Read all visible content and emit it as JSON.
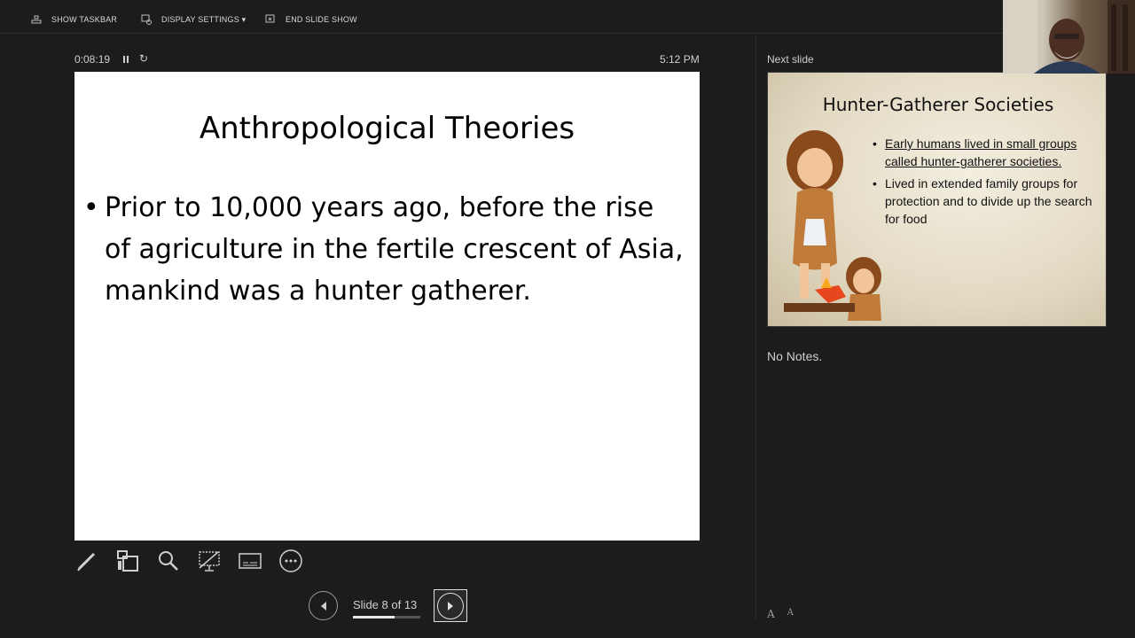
{
  "toolbar": {
    "show_taskbar": "SHOW TASKBAR",
    "display_settings": "DISPLAY SETTINGS ▾",
    "end_slide_show": "END SLIDE SHOW"
  },
  "presenter": {
    "elapsed_time": "0:08:19",
    "clock": "5:12 PM",
    "current_slide": {
      "title": "Anthropological Theories",
      "bullets": [
        "Prior to 10,000 years ago, before the rise of agriculture in the fertile crescent of Asia, mankind was a hunter gatherer."
      ]
    },
    "slide_counter": "Slide 8 of 13",
    "progress_fraction": 0.615
  },
  "next_slide": {
    "label": "Next slide",
    "title": "Hunter-Gatherer Societies",
    "bullets": [
      "Early humans lived in small groups called hunter-gatherer societies.",
      "Lived in extended family groups for protection and to divide up the search for food"
    ]
  },
  "notes": {
    "text": "No Notes."
  },
  "font_controls": {
    "increase": "A",
    "decrease": "A"
  },
  "icons": [
    "taskbar-icon",
    "display-settings-icon",
    "end-show-icon",
    "pen-icon",
    "slides-grid-icon",
    "zoom-icon",
    "black-screen-icon",
    "subtitles-icon",
    "more-options-icon",
    "previous-arrow-icon",
    "next-arrow-icon"
  ],
  "colors": {
    "background": "#1c1c1c",
    "slide": "#ffffff",
    "text": "#cfcfcf"
  }
}
